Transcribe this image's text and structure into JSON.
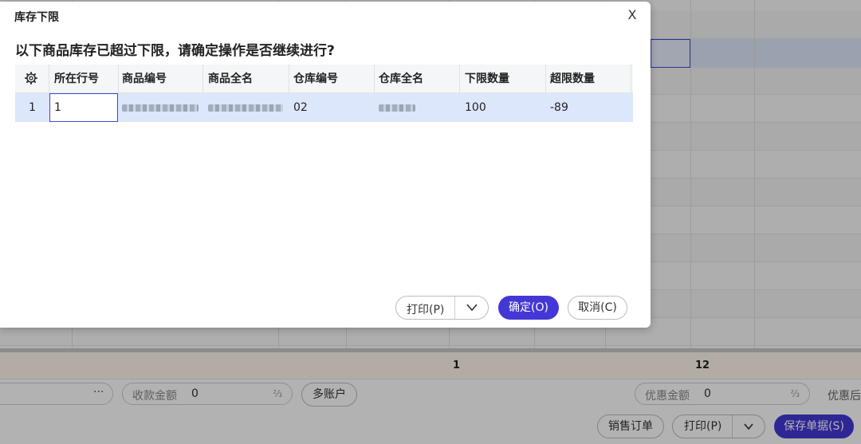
{
  "dialog": {
    "title": "库存下限",
    "close_label": "X",
    "message": "以下商品库存已超过下限，请确定操作是否继续进行?",
    "columns": [
      "所在行号",
      "商品编号",
      "商品全名",
      "仓库编号",
      "仓库全名",
      "下限数量",
      "超限数量"
    ],
    "rows": [
      {
        "index": "1",
        "line_no": "1",
        "product_code": "",
        "product_name": "",
        "warehouse_code": "02",
        "warehouse_name": "",
        "lower_limit": "100",
        "over_limit": "-89"
      }
    ],
    "buttons": {
      "print": "打印(P)",
      "ok": "确定(O)",
      "cancel": "取消(C)"
    }
  },
  "background": {
    "summary": {
      "value1": "1",
      "value2": "12"
    },
    "footer": {
      "ellipsis": "···",
      "received_amount_label": "收款金额",
      "received_amount_value": "0",
      "percent_icon": "⅔",
      "multi_account": "多账户",
      "discount_amount_label": "优惠金额",
      "discount_amount_value": "0",
      "discount_after_label": "优惠后",
      "sales_order": "销售订单",
      "print": "打印(P)",
      "save": "保存单据(S)"
    }
  },
  "colors": {
    "primary": "#4437d6",
    "row_highlight": "#dde7fb",
    "active_cell_border": "#3b4bd4"
  }
}
